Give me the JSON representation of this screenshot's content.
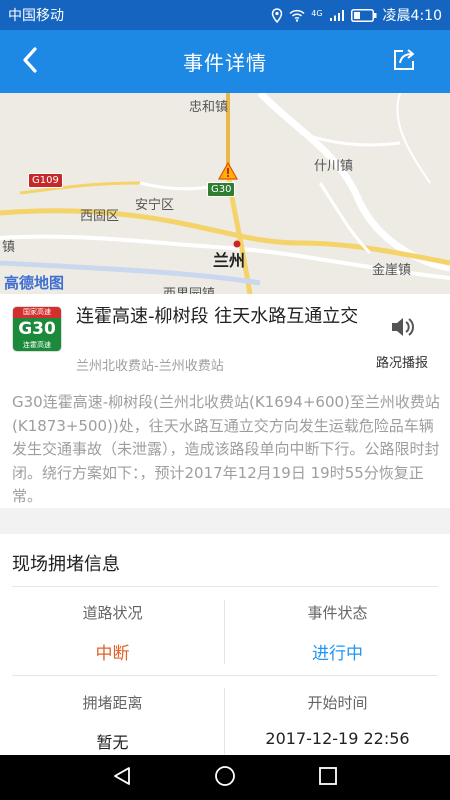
{
  "status_bar": {
    "carrier": "中国移动",
    "network": "4G",
    "time": "凌晨4:10"
  },
  "app_bar": {
    "title": "事件详情",
    "back_icon": "back-arrow-icon",
    "share_icon": "share-icon"
  },
  "map": {
    "labels": {
      "zhonghe": "忠和镇",
      "shichuan": "什川镇",
      "xigu": "西固区",
      "anning": "安宁区",
      "lanzhou": "兰州",
      "jie": "镇",
      "jinya": "金崖镇",
      "bottom_partial": "西果园镇"
    },
    "shields": {
      "g109": "G109",
      "g30": "G30"
    },
    "logo": "高德地图"
  },
  "road": {
    "badge_top": "国家高速",
    "badge_code": "G30",
    "badge_name": "连霍高速",
    "title": "连霍高速-柳树段  往天水路互通立交",
    "subtitle": "兰州北收费站-兰州收费站",
    "broadcast_label": "路况播报"
  },
  "description": "G30连霍高速-柳树段(兰州北收费站(K1694+600)至兰州收费站(K1873+500))处，往天水路互通立交方向发生运载危险品车辆发生交通事故（未泄露），造成该路段单向中断下行。公路限时封闭。绕行方案如下：，预计2017年12月19日 19时55分恢复正常。",
  "congestion": {
    "section_title": "现场拥堵信息",
    "road_status_label": "道路状况",
    "road_status_value": "中断",
    "event_status_label": "事件状态",
    "event_status_value": "进行中",
    "distance_label": "拥堵距离",
    "distance_value": "暂无",
    "start_time_label": "开始时间",
    "start_time_value": "2017-12-19 22:56"
  },
  "colors": {
    "status_bar": "#1565c0",
    "app_bar": "#1e88e5",
    "road_status": "#e0602a",
    "event_status": "#2196f3"
  }
}
